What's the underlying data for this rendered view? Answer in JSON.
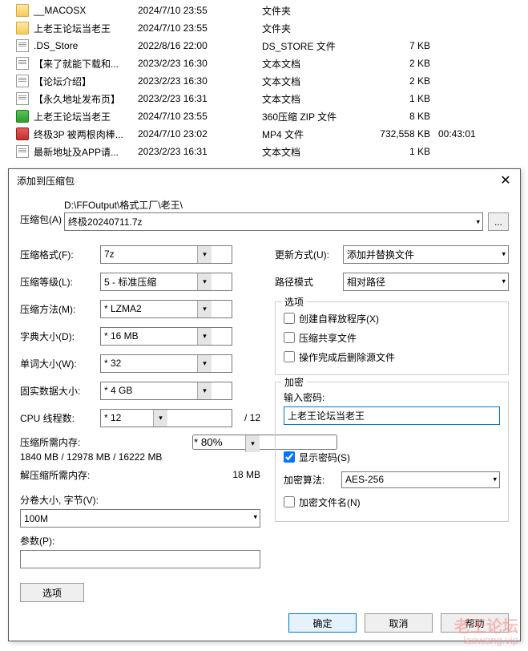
{
  "files": [
    {
      "icon": "folder",
      "name": "__MACOSX",
      "date": "2024/7/10 23:55",
      "type": "文件夹",
      "size": "",
      "duration": ""
    },
    {
      "icon": "folder",
      "name": "上老王论坛当老王",
      "date": "2024/7/10 23:55",
      "type": "文件夹",
      "size": "",
      "duration": ""
    },
    {
      "icon": "file",
      "name": ".DS_Store",
      "date": "2022/8/16 22:00",
      "type": "DS_STORE 文件",
      "size": "7 KB",
      "duration": ""
    },
    {
      "icon": "file",
      "name": "【来了就能下载和...",
      "date": "2023/2/23 16:30",
      "type": "文本文档",
      "size": "2 KB",
      "duration": ""
    },
    {
      "icon": "file",
      "name": "【论坛介绍】",
      "date": "2023/2/23 16:30",
      "type": "文本文档",
      "size": "2 KB",
      "duration": ""
    },
    {
      "icon": "file",
      "name": "【永久地址发布页】",
      "date": "2023/2/23 16:31",
      "type": "文本文档",
      "size": "1 KB",
      "duration": ""
    },
    {
      "icon": "green",
      "name": "上老王论坛当老王",
      "date": "2024/7/10 23:55",
      "type": "360压缩 ZIP 文件",
      "size": "8 KB",
      "duration": ""
    },
    {
      "icon": "red",
      "name": "终极3P 被两根肉棒...",
      "date": "2024/7/10 23:02",
      "type": "MP4 文件",
      "size": "732,558 KB",
      "duration": "00:43:01"
    },
    {
      "icon": "file",
      "name": "最新地址及APP请...",
      "date": "2023/2/23 16:31",
      "type": "文本文档",
      "size": "1 KB",
      "duration": ""
    }
  ],
  "dialog": {
    "title": "添加到压缩包",
    "archive_label": "压缩包(A)",
    "archive_path": "D:\\FFOutput\\格式工厂\\老王\\",
    "archive_file": "终极20240711.7z",
    "browse": "...",
    "left": {
      "format_label": "压缩格式(F):",
      "format_value": "7z",
      "level_label": "压缩等级(L):",
      "level_value": "5 - 标准压缩",
      "method_label": "压缩方法(M):",
      "method_value": "* LZMA2",
      "dict_label": "字典大小(D):",
      "dict_value": "* 16 MB",
      "word_label": "单词大小(W):",
      "word_value": "* 32",
      "solid_label": "固实数据大小:",
      "solid_value": "* 4 GB",
      "cpu_label": "CPU 线程数:",
      "cpu_value": "* 12",
      "cpu_total": "/ 12",
      "mem_compress_label": "压缩所需内存:",
      "mem_pct": "* 80%",
      "mem_compress_value": "1840 MB / 12978 MB / 16222 MB",
      "mem_decompress_label": "解压缩所需内存:",
      "mem_decompress_value": "18 MB",
      "volume_label": "分卷大小, 字节(V):",
      "volume_value": "100M",
      "params_label": "参数(P):",
      "params_value": "",
      "options_btn": "选项"
    },
    "right": {
      "update_label": "更新方式(U):",
      "update_value": "添加并替换文件",
      "pathmode_label": "路径模式",
      "pathmode_value": "相对路径",
      "options_group": "选项",
      "opt_sfx": "创建自释放程序(X)",
      "opt_shared": "压缩共享文件",
      "opt_delete": "操作完成后删除源文件",
      "enc_group": "加密",
      "pwd_label": "输入密码:",
      "pwd_value": "上老王论坛当老王",
      "show_pwd": "显示密码(S)",
      "enc_alg_label": "加密算法:",
      "enc_alg_value": "AES-256",
      "enc_names": "加密文件名(N)"
    },
    "ok": "确定",
    "cancel": "取消",
    "help": "帮助"
  },
  "watermark": {
    "line1": "老王论坛",
    "line2": "laowang.vip"
  }
}
